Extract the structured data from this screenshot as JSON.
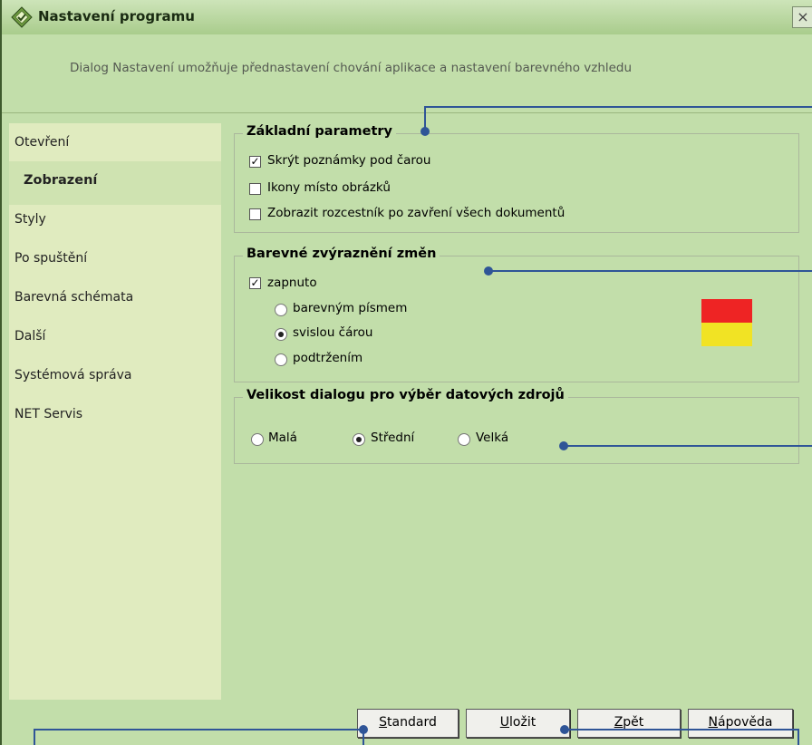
{
  "window": {
    "title": "Nastavení programu",
    "close_glyph": "×"
  },
  "description": "Dialog Nastavení umožňuje přednastavení chování aplikace a nastavení barevného vzhledu",
  "sidebar": {
    "items": [
      {
        "label": "Otevření"
      },
      {
        "label": "Zobrazení",
        "selected": true
      },
      {
        "label": "Styly"
      },
      {
        "label": "Po spuštění"
      },
      {
        "label": "Barevná schémata"
      },
      {
        "label": "Další"
      },
      {
        "label": "Systémová správa"
      },
      {
        "label": "NET Servis"
      }
    ]
  },
  "basic": {
    "title": "Základní parametry",
    "options": [
      {
        "label": "Skrýt poznámky pod čarou",
        "checked": true
      },
      {
        "label": "Ikony místo obrázků",
        "checked": false
      },
      {
        "label": "Zobrazit rozcestník po zavření všech dokumentů",
        "checked": false
      }
    ]
  },
  "highlight": {
    "title": "Barevné zvýraznění změn",
    "enabled_label": "zapnuto",
    "enabled": true,
    "modes": [
      {
        "label": "barevným písmem",
        "selected": false
      },
      {
        "label": "svislou čárou",
        "selected": true
      },
      {
        "label": "podtržením",
        "selected": false
      }
    ],
    "colors": [
      "#ee2424",
      "#f1e324"
    ]
  },
  "dialog_size": {
    "title": "Velikost dialogu pro výběr datových zdrojů",
    "options": [
      {
        "label": "Malá",
        "selected": false
      },
      {
        "label": "Střední",
        "selected": true
      },
      {
        "label": "Velká",
        "selected": false
      }
    ]
  },
  "buttons": {
    "standard": {
      "accel": "S",
      "rest": "tandard"
    },
    "save": {
      "accel": "U",
      "rest": "ložit"
    },
    "back": {
      "accel": "Z",
      "rest": "pět"
    },
    "help": {
      "accel": "N",
      "rest": "ápověda"
    }
  },
  "colors": {
    "window_bg": "#c2deaa",
    "sidebar_bg": "#e0ebbf",
    "callout": "#2f5597"
  },
  "icons": {
    "app": "app-diamond-icon",
    "close": "close-icon"
  }
}
